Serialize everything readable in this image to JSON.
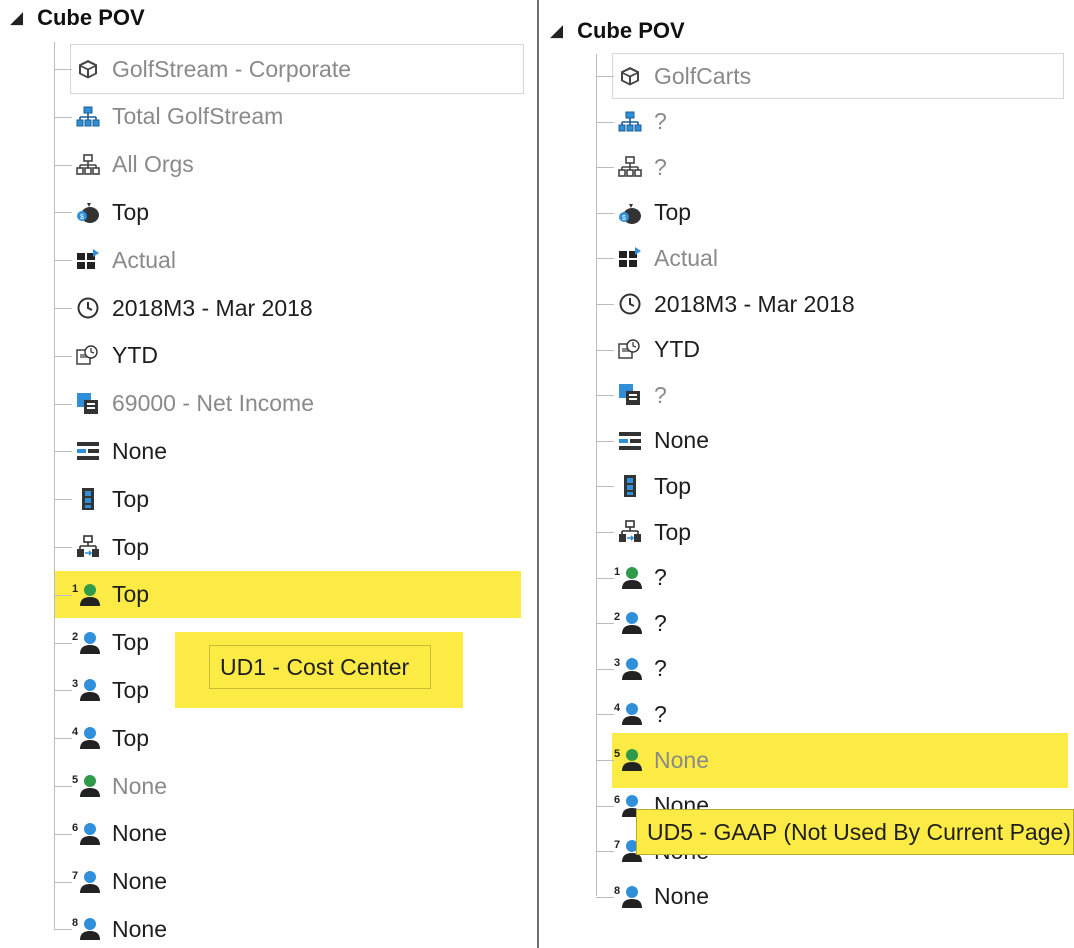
{
  "left": {
    "header": {
      "title": "Cube POV"
    },
    "rows": [
      {
        "icon": "cube-icon",
        "label": "GolfStream - Corporate",
        "tone": "gray"
      },
      {
        "icon": "entity-hierarchy-icon",
        "label": "Total GolfStream",
        "tone": "gray"
      },
      {
        "icon": "parent-hierarchy-icon",
        "label": "All Orgs",
        "tone": "gray"
      },
      {
        "icon": "consolidation-money-bag-icon",
        "label": "Top",
        "tone": "dark"
      },
      {
        "icon": "scenario-icon",
        "label": "Actual",
        "tone": "gray"
      },
      {
        "icon": "clock-icon",
        "label": "2018M3 - Mar 2018",
        "tone": "dark"
      },
      {
        "icon": "view-icon",
        "label": "YTD",
        "tone": "dark"
      },
      {
        "icon": "account-icon",
        "label": "69000 - Net Income",
        "tone": "gray"
      },
      {
        "icon": "flow-icon",
        "label": "None",
        "tone": "dark"
      },
      {
        "icon": "origin-icon",
        "label": "Top",
        "tone": "dark"
      },
      {
        "icon": "intercompany-icon",
        "label": "Top",
        "tone": "dark"
      },
      {
        "icon": "ud1-user-icon",
        "num": "1",
        "label": "Top",
        "tone": "dark"
      },
      {
        "icon": "ud2-user-icon",
        "num": "2",
        "label": "Top",
        "tone": "dark"
      },
      {
        "icon": "ud3-user-icon",
        "num": "3",
        "label": "Top",
        "tone": "dark"
      },
      {
        "icon": "ud4-user-icon",
        "num": "4",
        "label": "Top",
        "tone": "dark"
      },
      {
        "icon": "ud5-user-icon",
        "num": "5",
        "label": "None",
        "tone": "gray"
      },
      {
        "icon": "ud6-user-icon",
        "num": "6",
        "label": "None",
        "tone": "dark"
      },
      {
        "icon": "ud7-user-icon",
        "num": "7",
        "label": "None",
        "tone": "dark"
      },
      {
        "icon": "ud8-user-icon",
        "num": "8",
        "label": "None",
        "tone": "dark"
      }
    ],
    "tooltip": "UD1 - Cost Center"
  },
  "right": {
    "header": {
      "title": "Cube POV"
    },
    "rows": [
      {
        "icon": "cube-icon",
        "label": "GolfCarts",
        "tone": "gray"
      },
      {
        "icon": "entity-hierarchy-icon",
        "label": "?",
        "tone": "gray"
      },
      {
        "icon": "parent-hierarchy-icon",
        "label": "?",
        "tone": "gray"
      },
      {
        "icon": "consolidation-money-bag-icon",
        "label": "Top",
        "tone": "dark"
      },
      {
        "icon": "scenario-icon",
        "label": "Actual",
        "tone": "gray"
      },
      {
        "icon": "clock-icon",
        "label": "2018M3 - Mar 2018",
        "tone": "dark"
      },
      {
        "icon": "view-icon",
        "label": "YTD",
        "tone": "dark"
      },
      {
        "icon": "account-icon",
        "label": "?",
        "tone": "gray"
      },
      {
        "icon": "flow-icon",
        "label": "None",
        "tone": "dark"
      },
      {
        "icon": "origin-icon",
        "label": "Top",
        "tone": "dark"
      },
      {
        "icon": "intercompany-icon",
        "label": "Top",
        "tone": "dark"
      },
      {
        "icon": "ud1-user-icon",
        "num": "1",
        "label": "?",
        "tone": "dark"
      },
      {
        "icon": "ud2-user-icon",
        "num": "2",
        "label": "?",
        "tone": "dark"
      },
      {
        "icon": "ud3-user-icon",
        "num": "3",
        "label": "?",
        "tone": "dark"
      },
      {
        "icon": "ud4-user-icon",
        "num": "4",
        "label": "?",
        "tone": "dark"
      },
      {
        "icon": "ud5-user-icon",
        "num": "5",
        "label": "None",
        "tone": "gray"
      },
      {
        "icon": "ud6-user-icon",
        "num": "6",
        "label": "None",
        "tone": "dark"
      },
      {
        "icon": "ud7-user-icon",
        "num": "7",
        "label": "None",
        "tone": "dark"
      },
      {
        "icon": "ud8-user-icon",
        "num": "8",
        "label": "None",
        "tone": "dark"
      }
    ],
    "tooltip": "UD5 - GAAP (Not Used By Current Page)"
  },
  "colors": {
    "highlight": "#fdeb45",
    "gray_text": "#8a8a8a",
    "dark_text": "#1e1e1e",
    "icon_blue": "#2f8fd8",
    "icon_green": "#2e9a4a"
  }
}
